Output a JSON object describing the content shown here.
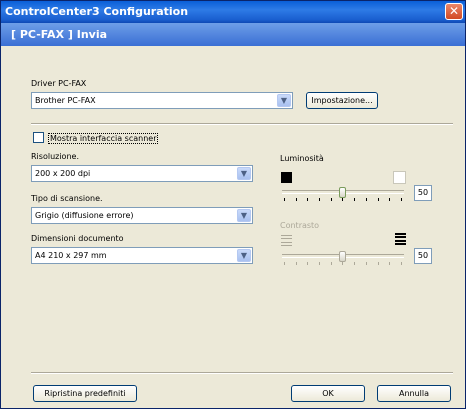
{
  "window": {
    "title": "ControlCenter3 Configuration",
    "close_glyph": "✕"
  },
  "header": {
    "title": "[ PC-FAX ]  Invia"
  },
  "driver": {
    "label": "Driver PC-FAX",
    "value": "Brother PC-FAX",
    "settings_button": "Impostazione..."
  },
  "scanner": {
    "show_interface_label": "Mostra interfaccia scanner",
    "show_interface_checked": false,
    "resolution_label": "Risoluzione.",
    "resolution_value": "200 x 200 dpi",
    "scan_type_label": "Tipo di scansione.",
    "scan_type_value": "Grigio (diffusione errore)",
    "doc_size_label": "Dimensioni documento",
    "doc_size_value": "A4 210 x 297 mm"
  },
  "brightness": {
    "label": "Luminosità",
    "value": "50",
    "level_percent": 50,
    "enabled": true
  },
  "contrast": {
    "label": "Contrasto",
    "value": "50",
    "level_percent": 50,
    "enabled": false
  },
  "footer": {
    "restore_defaults": "Ripristina predefiniti",
    "ok": "OK",
    "cancel": "Annulla"
  },
  "icons": {
    "dropdown": "chevron-down-icon",
    "close": "close-icon"
  }
}
